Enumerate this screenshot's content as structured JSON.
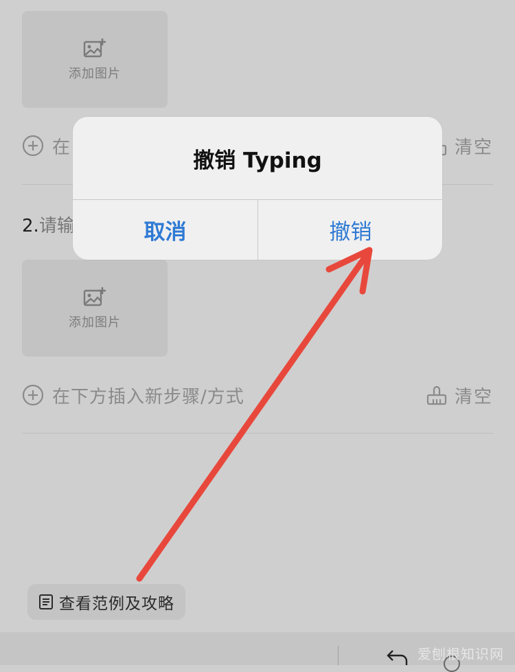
{
  "steps": [
    {
      "add_image_label": "添加图片",
      "insert_text_partial": "在",
      "clear_label": "清空"
    },
    {
      "label_number": "2.",
      "label_partial": "请输",
      "add_image_label": "添加图片",
      "insert_text": "在下方插入新步骤/方式",
      "clear_label": "清空"
    }
  ],
  "guide_button": {
    "label": "查看范例及攻略"
  },
  "dialog": {
    "title": "撤销 Typing",
    "cancel_label": "取消",
    "confirm_label": "撤销"
  },
  "watermark": "爱刨根知识网",
  "colors": {
    "dialog_button": "#2f7ad4",
    "annotation_arrow": "#e8483c",
    "overlay_background": "#cfcfcf"
  },
  "icons": [
    "image-add-icon",
    "plus-circle-icon",
    "broom-icon",
    "document-icon",
    "undo-icon"
  ]
}
